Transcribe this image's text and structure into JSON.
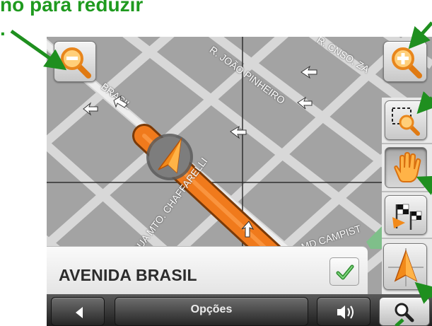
{
  "caption": {
    "line1": "no para reduzir",
    "line2": "."
  },
  "map": {
    "street_labels": [
      "BRASIL",
      "R. JOÃO PINHEIRO",
      "R. CNSO. ZA",
      "RUA MTO. CHAFFARELLI",
      "MD CAMPIST"
    ]
  },
  "info_bar": {
    "street_name": "AVENIDA BRASIL"
  },
  "bottom_bar": {
    "options_label": "Opções"
  },
  "icons": {
    "zoom_out": "zoom-out-icon",
    "zoom_in": "zoom-in-icon",
    "zoom_area": "zoom-area-icon",
    "pan_hand": "hand-icon",
    "route_flags": "checkered-flags-icon",
    "position_arrow": "navigation-arrow-icon",
    "search": "search-icon",
    "back": "back-arrow-icon",
    "volume": "speaker-icon",
    "confirm": "checkmark-icon"
  },
  "colors": {
    "route": "#e86a17",
    "annotation_arrow": "#1f8f1f",
    "map_block": "#a2a2a2",
    "map_street": "#d6d6d6"
  }
}
